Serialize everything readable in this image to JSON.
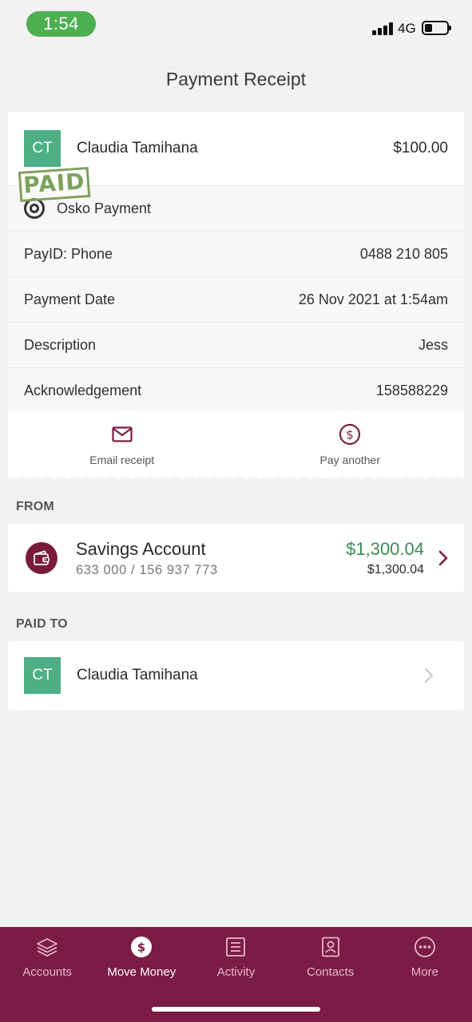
{
  "status_bar": {
    "time": "1:54",
    "network": "4G"
  },
  "header": {
    "title": "Payment Receipt"
  },
  "receipt": {
    "payee_initials": "CT",
    "payee_name": "Claudia Tamihana",
    "amount": "$100.00",
    "stamp": "PAID",
    "payment_method": "Osko Payment",
    "details": [
      {
        "label": "PayID: Phone",
        "value": "0488 210 805"
      },
      {
        "label": "Payment Date",
        "value": "26 Nov 2021 at 1:54am"
      },
      {
        "label": "Description",
        "value": "Jess"
      },
      {
        "label": "Acknowledgement",
        "value": "158588229"
      }
    ],
    "actions": {
      "email_label": "Email receipt",
      "pay_another_label": "Pay another"
    }
  },
  "from": {
    "section_label": "FROM",
    "account_name": "Savings Account",
    "account_number": "633 000  /  156 937 773",
    "available_balance": "$1,300.04",
    "current_balance": "$1,300.04"
  },
  "paid_to": {
    "section_label": "PAID TO",
    "initials": "CT",
    "name": "Claudia Tamihana"
  },
  "tab_bar": {
    "active": "Move Money",
    "items": [
      {
        "label": "Accounts",
        "icon": "layers-icon"
      },
      {
        "label": "Move Money",
        "icon": "dollar-circle-icon"
      },
      {
        "label": "Activity",
        "icon": "list-icon"
      },
      {
        "label": "Contacts",
        "icon": "contact-book-icon"
      },
      {
        "label": "More",
        "icon": "more-dots-icon"
      }
    ]
  },
  "colors": {
    "brand": "#7b1c44",
    "avatar": "#4eae86",
    "balance_green": "#3d8a55",
    "status_pill": "#4caf50"
  }
}
